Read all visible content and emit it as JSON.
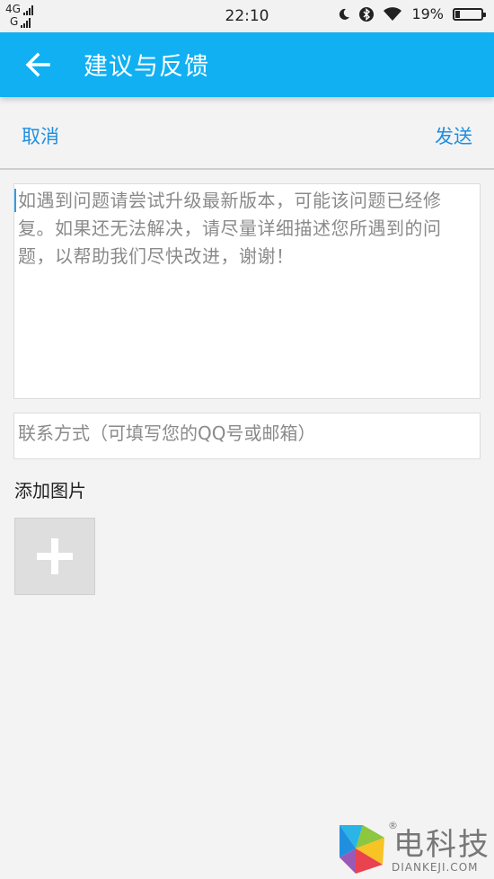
{
  "status_bar": {
    "network_top": "4G",
    "network_bottom": "G",
    "time": "22:10",
    "battery": "19%",
    "battery_level": 0.19,
    "icons": [
      "moon-icon",
      "bluetooth-icon",
      "wifi-icon",
      "battery-icon"
    ]
  },
  "app_bar": {
    "title": "建议与反馈",
    "back_icon": "arrow-left-icon",
    "color": "#10b0f3"
  },
  "actions": {
    "cancel_label": "取消",
    "send_label": "发送",
    "accent": "#1f8fe0"
  },
  "feedback": {
    "placeholder": "如遇到问题请尝试升级最新版本，可能该问题已经修复。如果还无法解决，请尽量详细描述您所遇到的问题，以帮助我们尽快改进，谢谢！"
  },
  "contact": {
    "placeholder": "联系方式（可填写您的QQ号或邮箱）"
  },
  "add_picture": {
    "label": "添加图片",
    "icon": "plus-icon"
  },
  "watermark": {
    "name": "电科技",
    "url": "DIANKEJI.COM",
    "reg": "®"
  }
}
